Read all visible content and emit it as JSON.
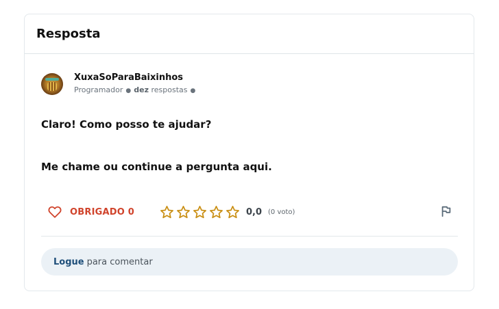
{
  "header": {
    "title": "Resposta"
  },
  "author": {
    "name": "XuxaSoParaBaixinhos",
    "role": "Programador",
    "answers_count": "dez",
    "answers_label": "respostas"
  },
  "answer": {
    "paragraphs": [
      "Claro! Como posso te ajudar?",
      "Me chame ou continue a pergunta aqui."
    ]
  },
  "actions": {
    "thanks_label": "OBRIGADO",
    "thanks_count": "0",
    "rating_value": "0,0",
    "rating_votes": "(0 voto)",
    "rating_stars_filled": 0,
    "rating_stars_total": 5
  },
  "comment": {
    "login_label": "Logue",
    "prompt": "para comentar"
  },
  "colors": {
    "thanks_red": "#d0432b",
    "star_gold": "#c98e12",
    "link_blue": "#1f4f7a",
    "comment_bg": "#ebf1f6"
  },
  "icons": [
    "heart-icon",
    "star-icon",
    "flag-icon"
  ]
}
